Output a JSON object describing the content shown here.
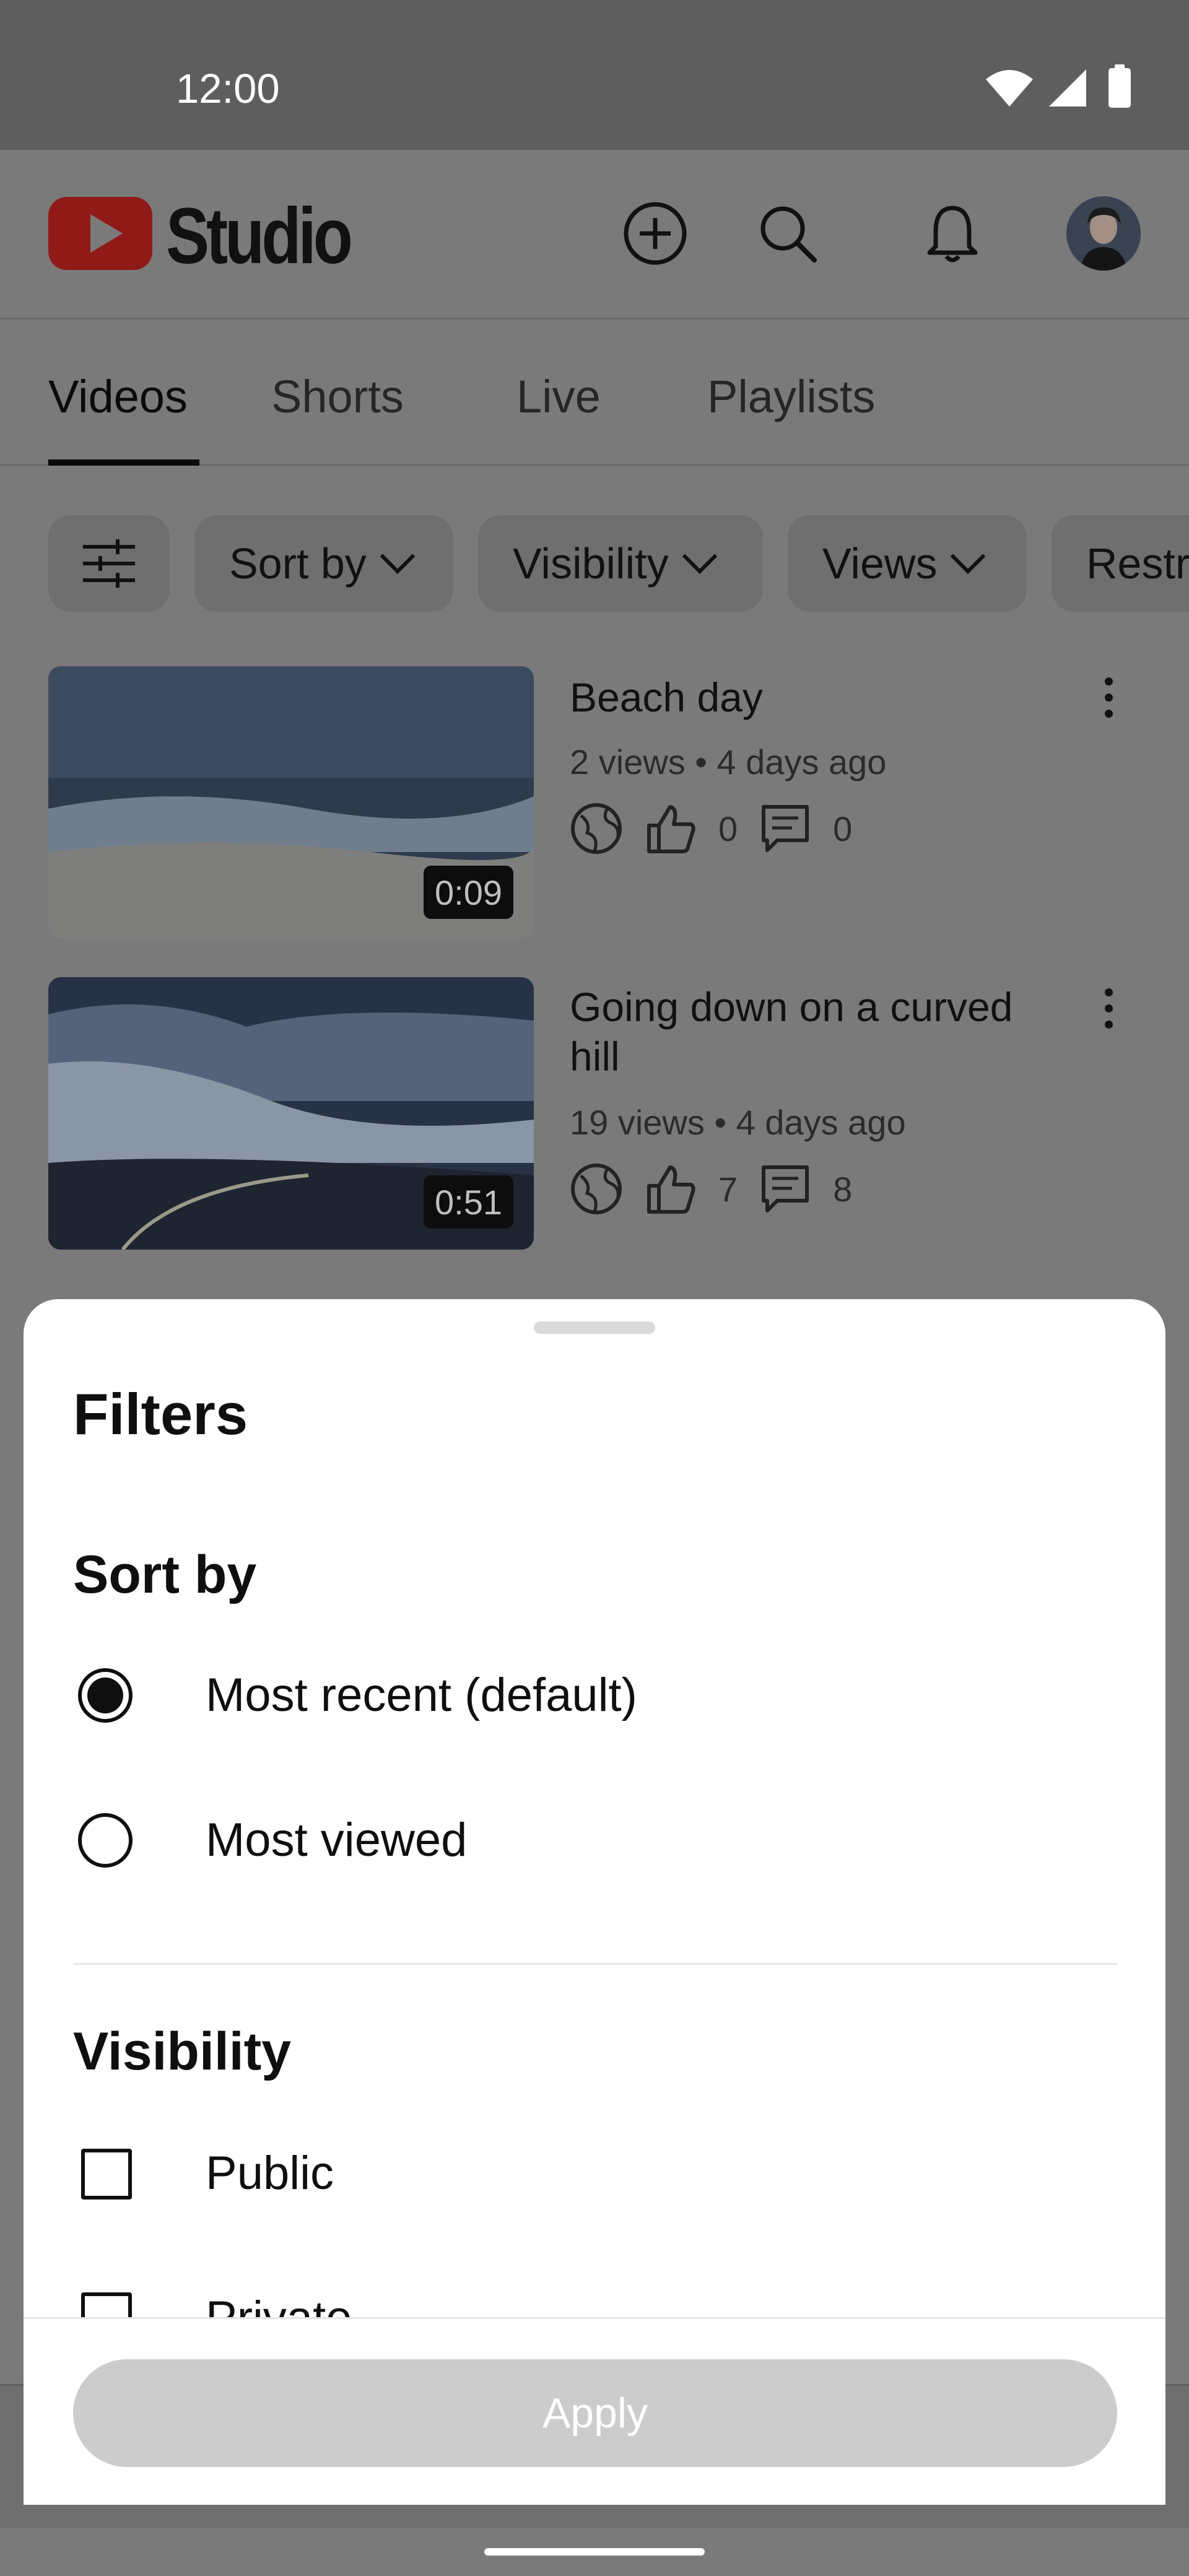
{
  "status_bar": {
    "time": "12:00"
  },
  "header": {
    "logo_text": "Studio"
  },
  "tabs": [
    {
      "label": "Videos",
      "active": true
    },
    {
      "label": "Shorts",
      "active": false
    },
    {
      "label": "Live",
      "active": false
    },
    {
      "label": "Playlists",
      "active": false
    }
  ],
  "chips": [
    "Sort by",
    "Visibility",
    "Views",
    "Restr"
  ],
  "videos": [
    {
      "title": "Beach day",
      "meta": "2 views • 4 days ago",
      "likes": "0",
      "comments": "0",
      "duration": "0:09"
    },
    {
      "title": "Going down on a curved hill",
      "meta": "19 views • 4 days ago",
      "likes": "7",
      "comments": "8",
      "duration": "0:51"
    }
  ],
  "sheet": {
    "title": "Filters",
    "sort_section": {
      "title": "Sort by",
      "options": [
        {
          "label": "Most recent (default)",
          "selected": true
        },
        {
          "label": "Most viewed",
          "selected": false
        }
      ]
    },
    "visibility_section": {
      "title": "Visibility",
      "options": [
        {
          "label": "Public",
          "checked": false
        },
        {
          "label": "Private",
          "checked": false
        }
      ]
    },
    "apply_label": "Apply"
  },
  "colors": {
    "scrim_bg": "#7a7a7a",
    "status_bar_bg": "#5e5e5e",
    "logo_red": "#8f1a17",
    "apply_disabled": "#cccccc"
  }
}
